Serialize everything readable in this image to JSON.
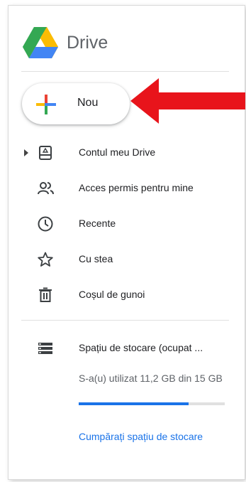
{
  "app": {
    "name": "Drive",
    "logo_icon": "google-drive-logo"
  },
  "new_button": {
    "label": "Nou",
    "icon": "plus-multicolor-icon"
  },
  "annotation": {
    "icon": "red-arrow-left",
    "color": "#e8141b"
  },
  "nav": {
    "items": [
      {
        "label": "Contul meu Drive",
        "icon": "my-drive-icon",
        "expandable": true
      },
      {
        "label": "Acces permis pentru mine",
        "icon": "shared-people-icon"
      },
      {
        "label": "Recente",
        "icon": "clock-icon"
      },
      {
        "label": "Cu stea",
        "icon": "star-icon"
      },
      {
        "label": "Coșul de gunoi",
        "icon": "trash-icon"
      }
    ]
  },
  "storage": {
    "title": "Spațiu de stocare (ocupat ...",
    "icon": "storage-icon",
    "usage_text": "S-a(u) utilizat 11,2 GB din 15 GB",
    "used_fraction": 0.75,
    "buy_link": "Cumpărați spațiu de stocare"
  },
  "colors": {
    "accent": "#1a73e8",
    "text": "#202124",
    "muted": "#5f6368",
    "arrow": "#e8141b"
  }
}
